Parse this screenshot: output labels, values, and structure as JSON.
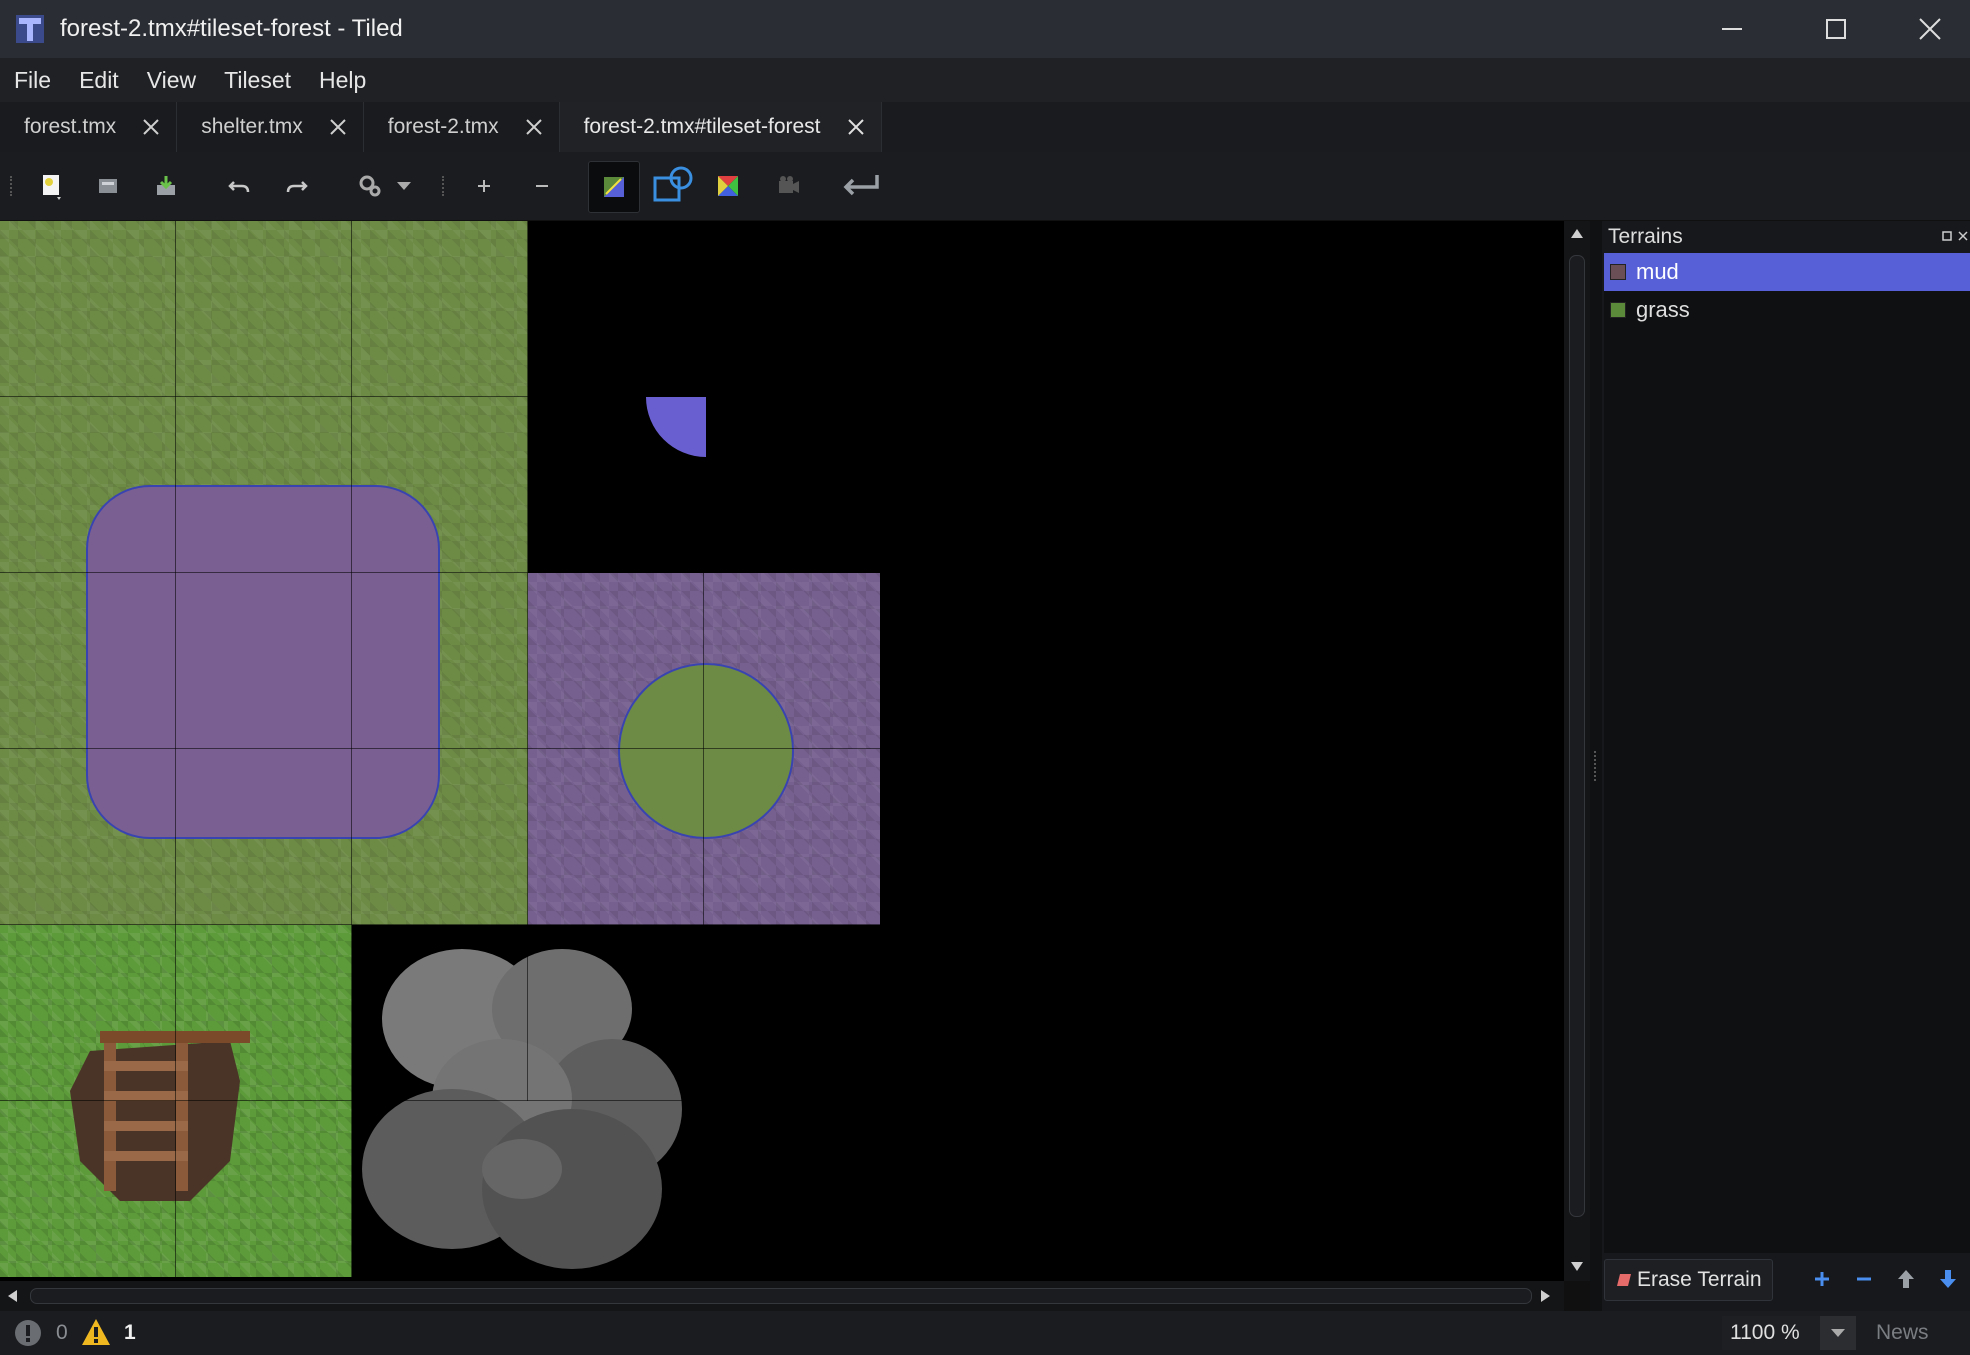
{
  "window": {
    "title": "forest-2.tmx#tileset-forest - Tiled",
    "icon": "tiled-app-icon"
  },
  "menu": [
    "File",
    "Edit",
    "View",
    "Tileset",
    "Help"
  ],
  "tabs": [
    {
      "label": "forest.tmx",
      "active": false
    },
    {
      "label": "shelter.tmx",
      "active": false
    },
    {
      "label": "forest-2.tmx",
      "active": false
    },
    {
      "label": "forest-2.tmx#tileset-forest",
      "active": true
    }
  ],
  "toolbar": {
    "icons": [
      "new-file-icon",
      "open-file-icon",
      "save-file-icon",
      "undo-icon",
      "redo-icon",
      "tileset-properties-icon",
      "dropdown-arrow-icon",
      "add-tiles-icon",
      "remove-tiles-icon",
      "terrain-edit-icon",
      "collision-edit-icon",
      "wang-sets-icon",
      "animation-editor-icon",
      "dynamic-wrapping-icon"
    ],
    "active": [
      "terrain-edit-icon"
    ]
  },
  "terrains_panel": {
    "title": "Terrains",
    "items": [
      {
        "name": "mud",
        "color": "#6b4f56",
        "selected": true
      },
      {
        "name": "grass",
        "color": "#5a8a3a",
        "selected": false
      }
    ],
    "erase_button": "Erase Terrain",
    "buttons": [
      "add-terrain-icon",
      "remove-terrain-icon",
      "move-up-icon",
      "move-down-icon"
    ]
  },
  "status": {
    "errors": "0",
    "warnings": "1",
    "zoom": "1100 %",
    "news": "News"
  },
  "colors": {
    "selection": "#5860d8",
    "terrain_overlay": "#6a5fd0",
    "grass": "#6e8b46",
    "mud": "#76608f"
  }
}
